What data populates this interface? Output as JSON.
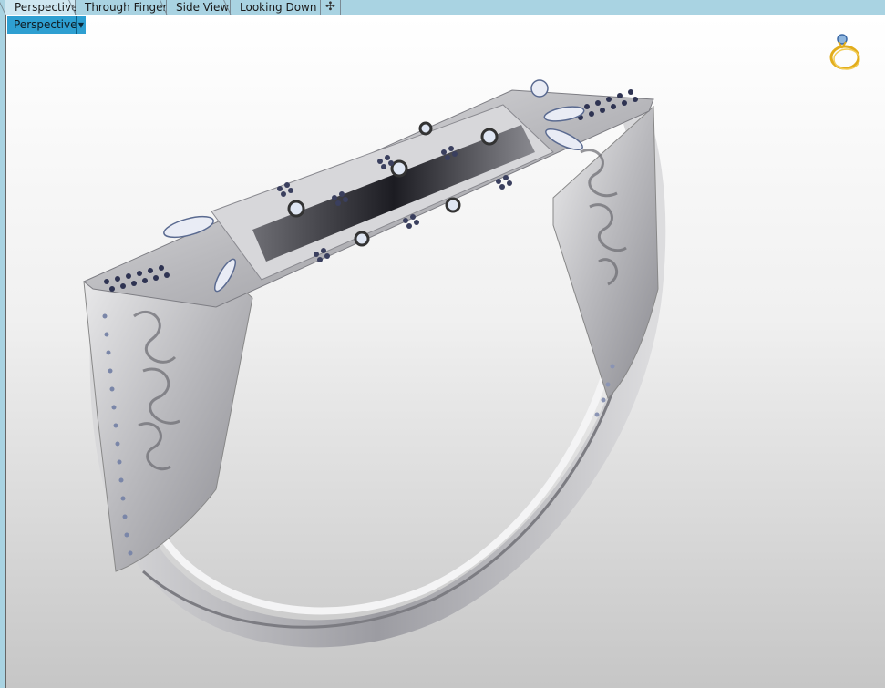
{
  "tabs": [
    {
      "label": "Perspective",
      "active": true
    },
    {
      "label": "Through Finger",
      "active": false
    },
    {
      "label": "Side View",
      "active": false
    },
    {
      "label": "Looking Down",
      "active": false
    }
  ],
  "add_tab_icon": "plus-icon",
  "viewport": {
    "label": "Perspective",
    "dropdown_icon": "triangle-down-icon",
    "corner_icon": "ring-icon"
  },
  "colors": {
    "tabbar": "#a9d3e2",
    "viewport_label_bg": "#2e9fd1",
    "metal": "#c9c9cc",
    "gems_dark": "#2a2f4a",
    "gold_icon": "#e8b520"
  }
}
